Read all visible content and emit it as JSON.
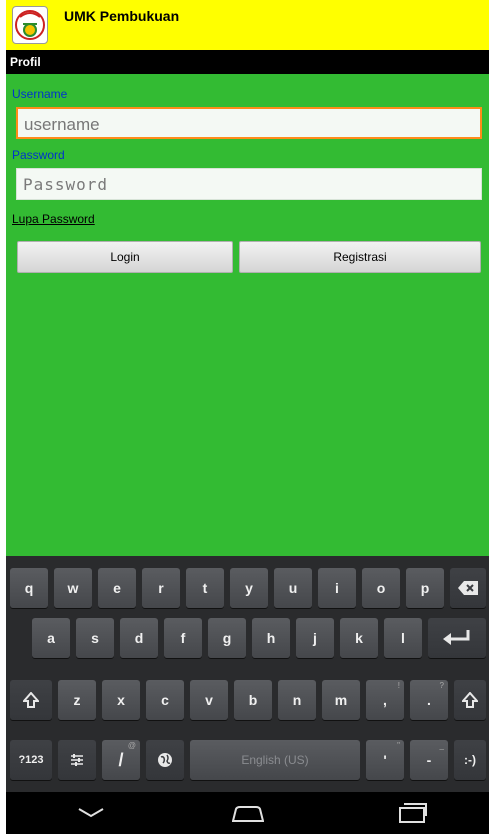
{
  "app": {
    "title": "UMK Pembukuan",
    "logo_text": "UMK"
  },
  "titlebar": {
    "title": "Profil"
  },
  "form": {
    "username_label": "Username",
    "username_placeholder": "username",
    "password_label": "Password",
    "password_placeholder": "Password",
    "forgot_link": "Lupa Password",
    "login_button": "Login",
    "register_button": "Registrasi"
  },
  "keyboard": {
    "row1": [
      "q",
      "w",
      "e",
      "r",
      "t",
      "y",
      "u",
      "i",
      "o",
      "p"
    ],
    "row2": [
      "a",
      "s",
      "d",
      "f",
      "g",
      "h",
      "j",
      "k",
      "l"
    ],
    "row3": [
      "z",
      "x",
      "c",
      "v",
      "b",
      "n",
      "m"
    ],
    "comma": ",",
    "comma_alt": "!",
    "period": ".",
    "period_alt": "?",
    "mode_label": "?123",
    "slash": "/",
    "slash_alt": "@",
    "space_label": "English (US)",
    "apostrophe": "'",
    "apostrophe_alt": "\"",
    "dash": "-",
    "dash_alt": "_",
    "smiley": ":-)"
  },
  "colors": {
    "appbar": "#ffff00",
    "content": "#33bb33",
    "label": "#0033cc",
    "focus": "#ff8c1a"
  }
}
